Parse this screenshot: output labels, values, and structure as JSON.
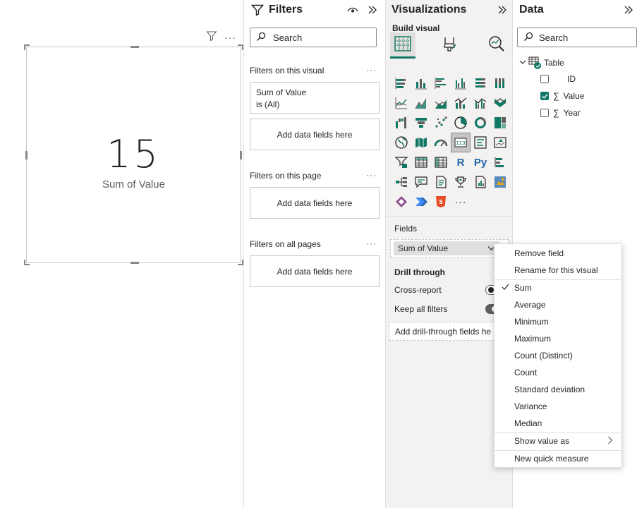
{
  "canvas": {
    "card": {
      "value": "15",
      "label": "Sum of Value"
    },
    "toolbar": {
      "filter_icon": "filter-icon",
      "more": "···"
    }
  },
  "filters": {
    "title": "Filters",
    "search_placeholder": "Search",
    "sections": {
      "visual": {
        "title": "Filters on this visual",
        "more": "···",
        "filter_card": {
          "name": "Sum of Value",
          "state": "is (All)"
        },
        "add": "Add data fields here"
      },
      "page": {
        "title": "Filters on this page",
        "more": "···",
        "add": "Add data fields here"
      },
      "all": {
        "title": "Filters on all pages",
        "more": "···",
        "add": "Add data fields here"
      }
    }
  },
  "visualizations": {
    "title": "Visualizations",
    "subtitle": "Build visual",
    "more": "···",
    "fields_label": "Fields",
    "field_value": "Sum of Value",
    "drill_title": "Drill through",
    "cross_report": "Cross-report",
    "keep_filters": "Keep all filters",
    "drill_well": "Add drill-through fields he",
    "r_label": "R",
    "py_label": "Py",
    "accent": "#117865"
  },
  "data": {
    "title": "Data",
    "search_placeholder": "Search",
    "table_name": "Table",
    "fields": [
      {
        "name": "ID",
        "checked": false,
        "sigma": false
      },
      {
        "name": "Value",
        "checked": true,
        "sigma": true
      },
      {
        "name": "Year",
        "checked": false,
        "sigma": true
      }
    ]
  },
  "context_menu": {
    "group1": [
      "Remove field",
      "Rename for this visual"
    ],
    "aggregations": [
      "Sum",
      "Average",
      "Minimum",
      "Maximum",
      "Count (Distinct)",
      "Count",
      "Standard deviation",
      "Variance",
      "Median"
    ],
    "selected": "Sum",
    "show_value_as": "Show value as",
    "new_measure": "New quick measure"
  }
}
